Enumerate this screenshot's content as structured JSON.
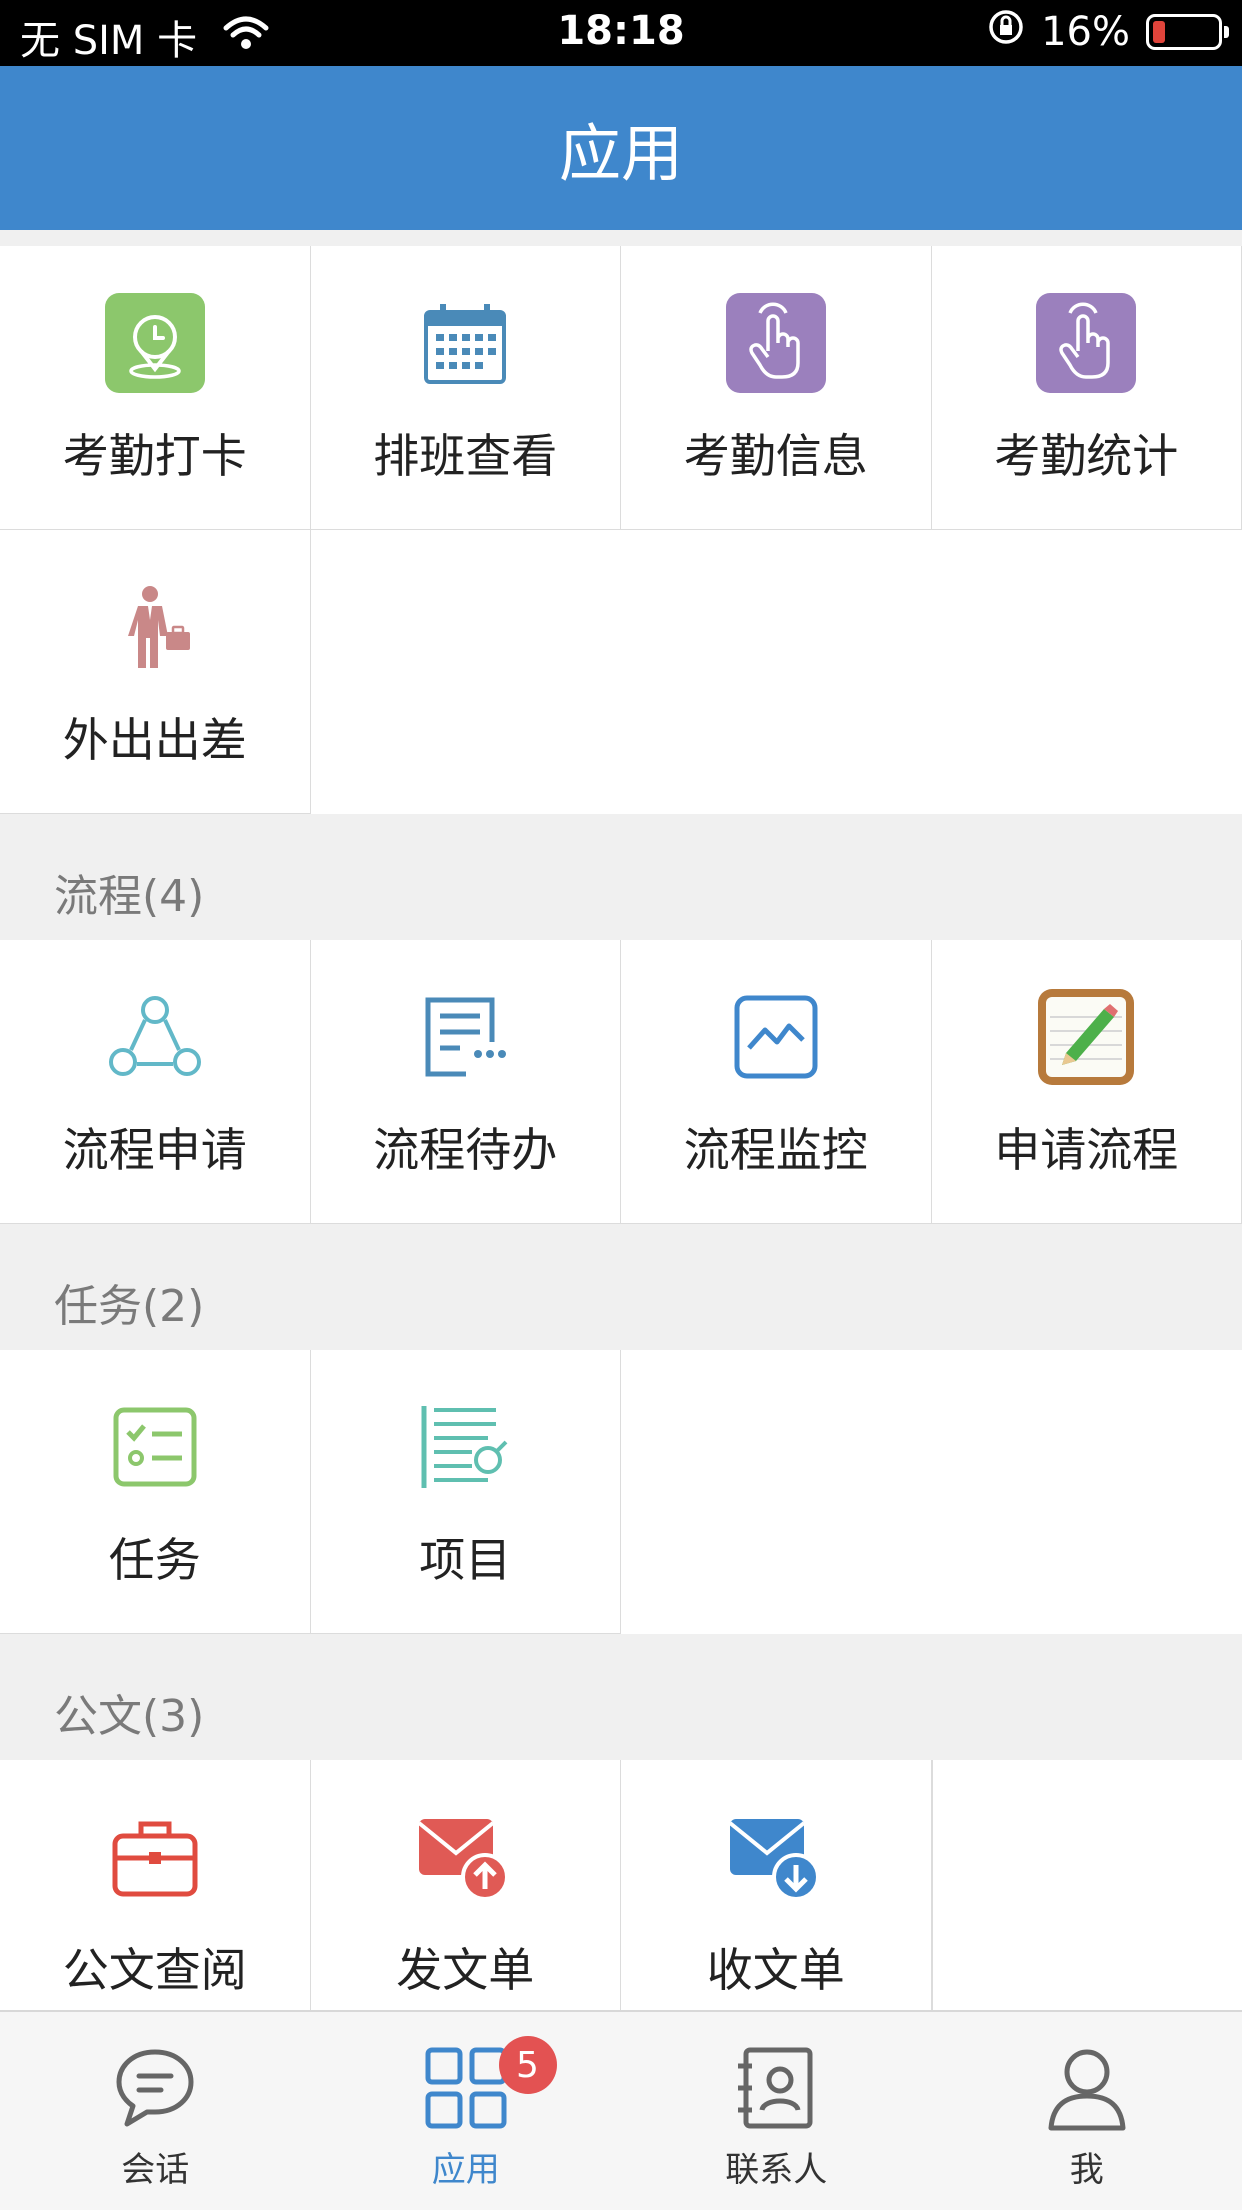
{
  "status_bar": {
    "carrier": "无 SIM 卡",
    "time": "18:18",
    "battery": "16%",
    "battery_level": 0.16
  },
  "header": {
    "title": "应用"
  },
  "attendance": {
    "items": [
      {
        "label": "考勤打卡",
        "icon": "clock-location-icon"
      },
      {
        "label": "排班查看",
        "icon": "calendar-icon"
      },
      {
        "label": "考勤信息",
        "icon": "finger-tap-icon"
      },
      {
        "label": "考勤统计",
        "icon": "finger-tap-icon"
      },
      {
        "label": "外出出差",
        "icon": "businessman-icon"
      }
    ]
  },
  "process": {
    "title": "流程(4)",
    "items": [
      {
        "label": "流程申请",
        "icon": "workflow-nodes-icon"
      },
      {
        "label": "流程待办",
        "icon": "todo-document-icon"
      },
      {
        "label": "流程监控",
        "icon": "monitor-chart-icon"
      },
      {
        "label": "申请流程",
        "icon": "notepad-pencil-icon"
      }
    ]
  },
  "task": {
    "title": "任务(2)",
    "items": [
      {
        "label": "任务",
        "icon": "checklist-icon"
      },
      {
        "label": "项目",
        "icon": "project-list-icon"
      }
    ]
  },
  "document": {
    "title": "公文(3)",
    "items": [
      {
        "label": "公文查阅",
        "icon": "briefcase-icon"
      },
      {
        "label": "发文单",
        "icon": "mail-send-icon"
      },
      {
        "label": "收文单",
        "icon": "mail-receive-icon"
      }
    ]
  },
  "tabbar": {
    "items": [
      {
        "label": "会话",
        "icon": "chat-bubble-icon"
      },
      {
        "label": "应用",
        "icon": "app-grid-icon",
        "badge": "5"
      },
      {
        "label": "联系人",
        "icon": "contact-card-icon"
      },
      {
        "label": "我",
        "icon": "person-icon"
      }
    ]
  },
  "colors": {
    "header": "#3f87cc",
    "badge": "#e35252",
    "active_tab": "#3f87cc"
  }
}
